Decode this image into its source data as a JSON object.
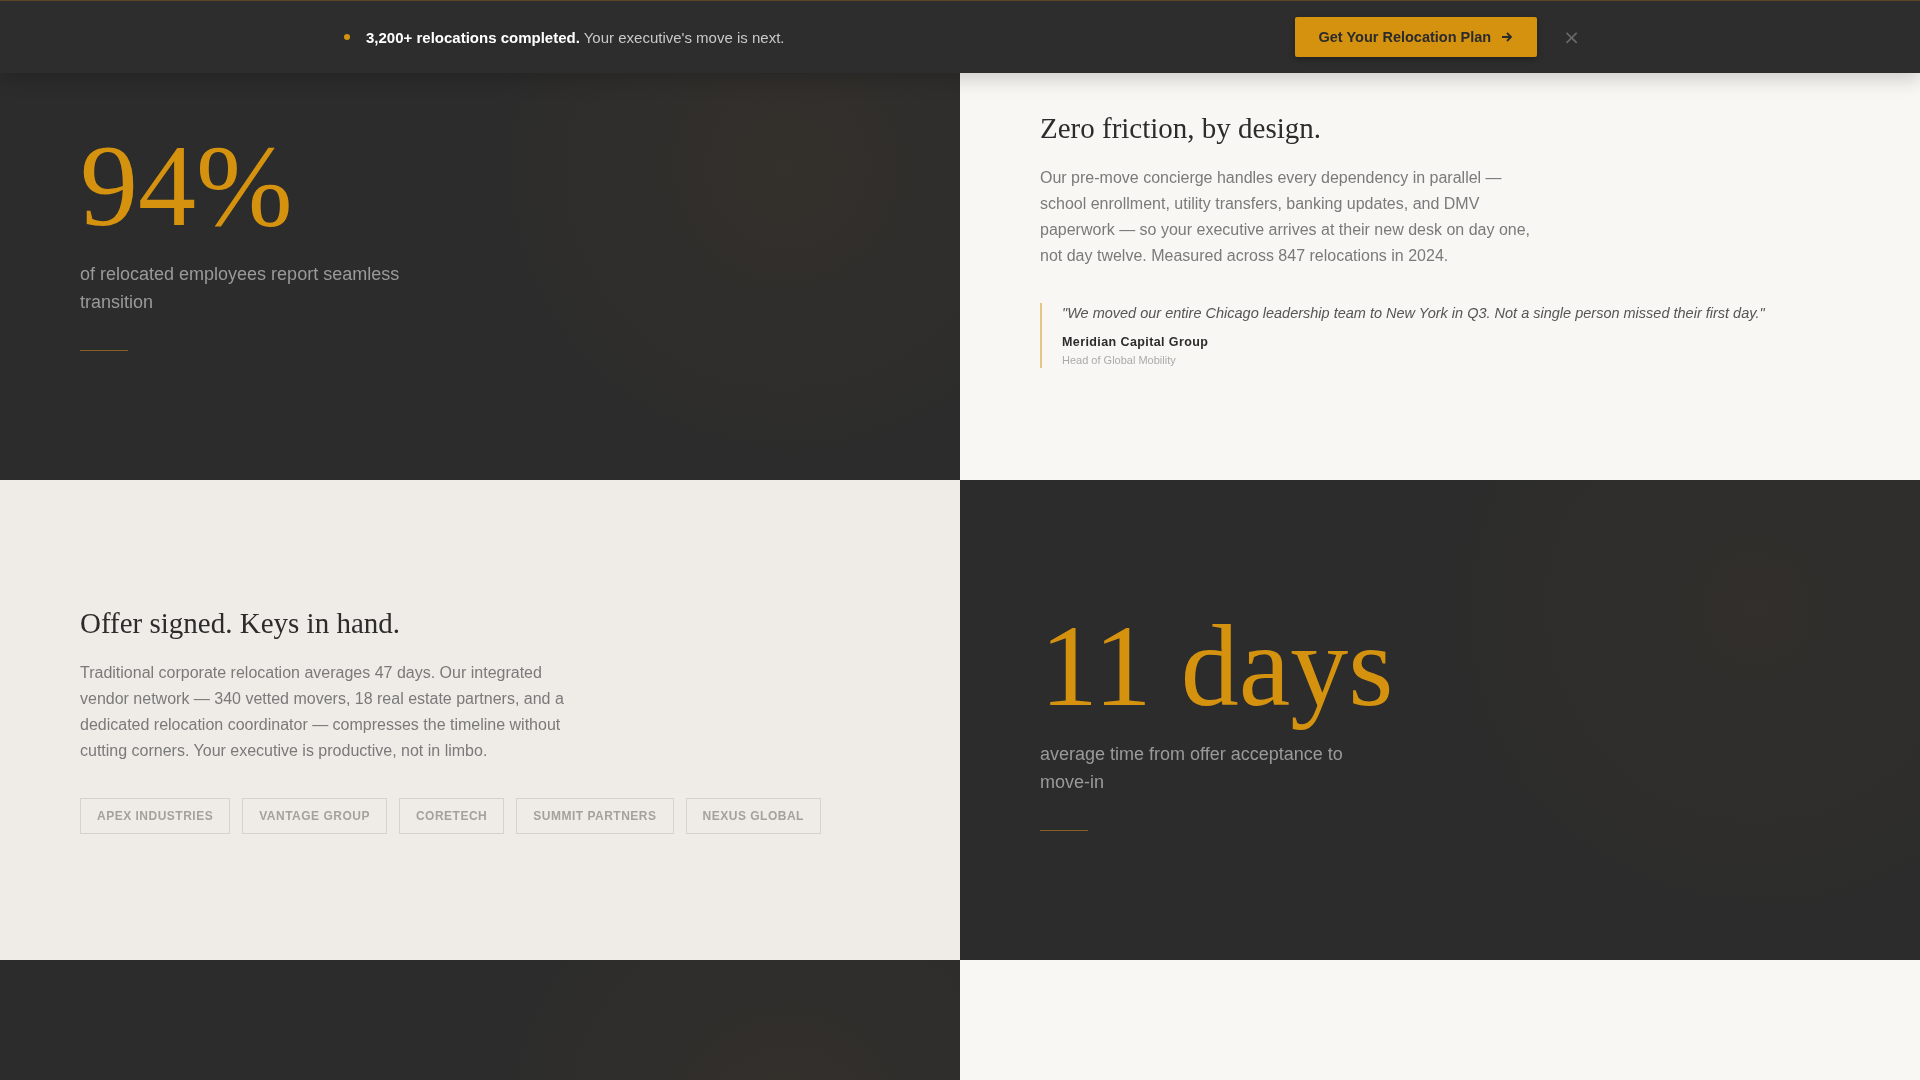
{
  "banner": {
    "highlight": "3,200+ relocations completed.",
    "text": "Your executive's move is next.",
    "button": "Get Your Relocation Plan",
    "close": "×"
  },
  "panels": [
    {
      "kind": "stat",
      "value": "94%",
      "caption": "of relocated employees report seamless transition"
    },
    {
      "kind": "text",
      "heading": "Zero friction, by design.",
      "body": "Our pre-move concierge handles every dependency in parallel — school enrollment, utility transfers, banking updates, and DMV paperwork — so your executive arrives at their new desk on day one, not day twelve. Measured across 847 relocations in 2024.",
      "quote": {
        "text": "\"We moved our entire Chicago leadership team to New York in Q3. Not a single person missed their first day.\"",
        "author": "Meridian Capital Group",
        "role": "Head of Global Mobility"
      }
    },
    {
      "kind": "text",
      "heading": "Offer signed. Keys in hand.",
      "body": "Traditional corporate relocation averages 47 days. Our integrated vendor network — 340 vetted movers, 18 real estate partners, and a dedicated relocation coordinator — compresses the timeline without cutting corners. Your executive is productive, not in limbo.",
      "clients": [
        "APEX INDUSTRIES",
        "VANTAGE GROUP",
        "CORETECH",
        "SUMMIT PARTNERS",
        "NEXUS GLOBAL"
      ]
    },
    {
      "kind": "stat",
      "value": "11 days",
      "caption": "average time from offer acceptance to move-in"
    },
    {
      "kind": "stat"
    },
    {
      "kind": "text"
    }
  ]
}
